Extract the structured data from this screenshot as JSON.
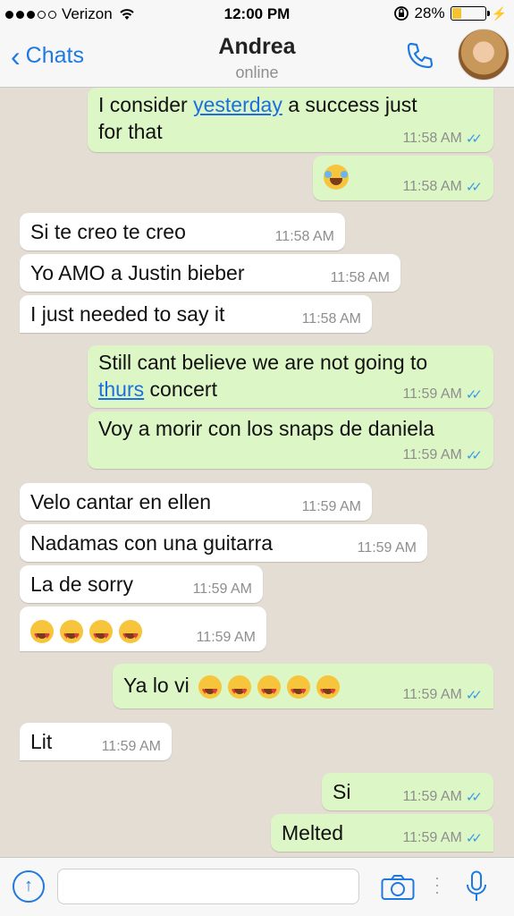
{
  "status_bar": {
    "carrier": "Verizon",
    "time": "12:00 PM",
    "battery": "28%",
    "battery_level": 0.28
  },
  "header": {
    "back_label": "Chats",
    "contact_name": "Andrea",
    "contact_status": "online"
  },
  "messages": [
    {
      "dir": "out",
      "parts": [
        "I consider ",
        "yesterday",
        " a success just",
        "for that"
      ],
      "time": "11:58 AM"
    },
    {
      "dir": "out",
      "emoji": "joy-emoji",
      "time": "11:58 AM"
    },
    {
      "dir": "in",
      "text": "Si te creo te creo",
      "time": "11:58 AM"
    },
    {
      "dir": "in",
      "text": "Yo AMO a Justin bieber",
      "time": "11:58 AM"
    },
    {
      "dir": "in",
      "text": "I just needed to say it",
      "time": "11:58 AM"
    },
    {
      "dir": "out",
      "parts": [
        "Still cant believe we are not going to",
        "thurs",
        " concert"
      ],
      "time": "11:59 AM"
    },
    {
      "dir": "out",
      "text": "Voy a morir con los snaps de daniela",
      "time": "11:59 AM"
    },
    {
      "dir": "in",
      "text": "Velo cantar en ellen",
      "time": "11:59 AM"
    },
    {
      "dir": "in",
      "text": "Nadamas con una guitarra",
      "time": "11:59 AM"
    },
    {
      "dir": "in",
      "text": "La de sorry",
      "time": "11:59 AM"
    },
    {
      "dir": "in",
      "emoji": "heart-eyes-emoji x4",
      "time": "11:59 AM"
    },
    {
      "dir": "out",
      "text": "Ya lo vi",
      "emoji": "heart-eyes-emoji x5",
      "time": "11:59 AM"
    },
    {
      "dir": "in",
      "text": "Lit",
      "time": "11:59 AM"
    },
    {
      "dir": "out",
      "text": "Si",
      "time": "11:59 AM"
    },
    {
      "dir": "out",
      "text": "Melted",
      "time": "11:59 AM"
    }
  ],
  "colors": {
    "accent": "#1e7ae0",
    "outgoing_bubble": "#dcf7c5",
    "incoming_bubble": "#ffffff",
    "read_ticks": "#3c9ae8",
    "background": "#e4ddd4"
  },
  "icons": [
    "wifi-icon",
    "lock-rotation-icon",
    "battery-icon",
    "charging-icon",
    "phone-icon",
    "upload-icon",
    "camera-icon",
    "more-icon",
    "microphone-icon"
  ]
}
